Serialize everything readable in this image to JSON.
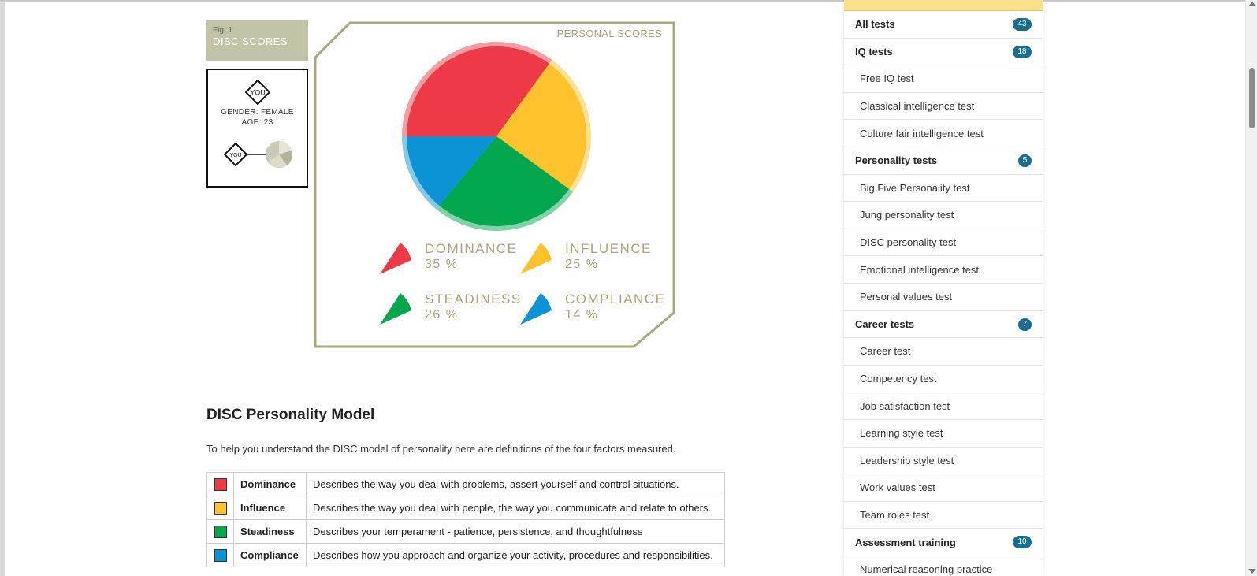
{
  "figure": {
    "fig_number": "Fig. 1",
    "fig_title": "DISC SCORES",
    "you_label": "YOU",
    "gender": "GENDER: FEMALE",
    "age": "AGE: 23",
    "panel_title": "PERSONAL SCORES"
  },
  "chart_data": {
    "type": "pie",
    "title": "PERSONAL SCORES",
    "slices": [
      {
        "label": "DOMINANCE",
        "value": 35,
        "display": "35 %",
        "color": "#ee3a46"
      },
      {
        "label": "INFLUENCE",
        "value": 25,
        "display": "25 %",
        "color": "#fdc22c"
      },
      {
        "label": "STEADINESS",
        "value": 26,
        "display": "26 %",
        "color": "#03a84e"
      },
      {
        "label": "COMPLIANCE",
        "value": 14,
        "display": "14 %",
        "color": "#0b93d6"
      }
    ]
  },
  "section": {
    "title": "DISC Personality Model",
    "intro": "To help you understand the DISC model of personality here are definitions of the four factors measured."
  },
  "factors": [
    {
      "name": "Dominance",
      "color": "#ee3a46",
      "description": "Describes the way you deal with problems, assert yourself and control situations."
    },
    {
      "name": "Influence",
      "color": "#fdc22c",
      "description": "Describes the way you deal with people, the way you communicate and relate to others."
    },
    {
      "name": "Steadiness",
      "color": "#03a84e",
      "description": "Describes your temperament - patience, persistence, and thoughtfulness"
    },
    {
      "name": "Compliance",
      "color": "#0b93d6",
      "description": "Describes how you approach and organize your activity, procedures and responsibilities."
    }
  ],
  "sidebar": {
    "items": [
      {
        "label": "All tests",
        "type": "cat",
        "count": "43"
      },
      {
        "label": "IQ tests",
        "type": "cat",
        "count": "18"
      },
      {
        "label": "Free IQ test",
        "type": "sub"
      },
      {
        "label": "Classical intelligence test",
        "type": "sub"
      },
      {
        "label": "Culture fair intelligence test",
        "type": "sub"
      },
      {
        "label": "Personality tests",
        "type": "cat",
        "count": "5"
      },
      {
        "label": "Big Five Personality test",
        "type": "sub"
      },
      {
        "label": "Jung personality test",
        "type": "sub"
      },
      {
        "label": "DISC personality test",
        "type": "sub"
      },
      {
        "label": "Emotional intelligence test",
        "type": "sub"
      },
      {
        "label": "Personal values test",
        "type": "sub"
      },
      {
        "label": "Career tests",
        "type": "cat",
        "count": "7"
      },
      {
        "label": "Career test",
        "type": "sub"
      },
      {
        "label": "Competency test",
        "type": "sub"
      },
      {
        "label": "Job satisfaction test",
        "type": "sub"
      },
      {
        "label": "Learning style test",
        "type": "sub"
      },
      {
        "label": "Leadership style test",
        "type": "sub"
      },
      {
        "label": "Work values test",
        "type": "sub"
      },
      {
        "label": "Team roles test",
        "type": "sub"
      },
      {
        "label": "Assessment training",
        "type": "cat",
        "count": "10"
      },
      {
        "label": "Numerical reasoning practice",
        "type": "sub"
      }
    ]
  }
}
